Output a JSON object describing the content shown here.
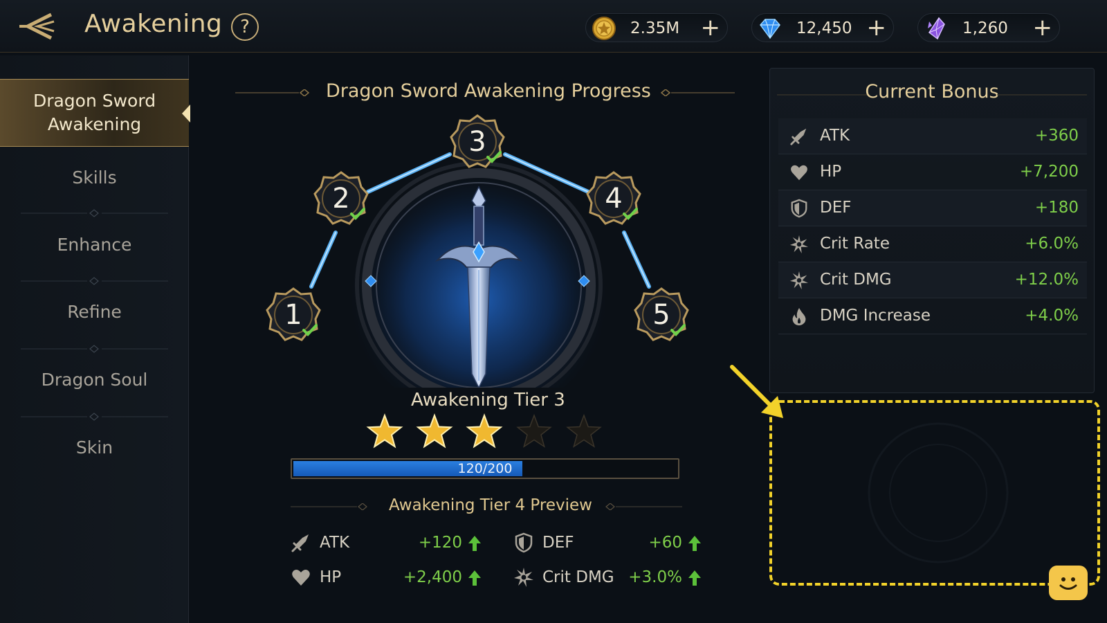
{
  "header": {
    "title": "Awakening",
    "help": "?",
    "currencies": [
      {
        "name": "gold",
        "value": "2.35M",
        "plus": "+"
      },
      {
        "name": "diamond",
        "value": "12,450",
        "plus": "+"
      },
      {
        "name": "crystal",
        "value": "1,260",
        "plus": "+"
      }
    ]
  },
  "sidebar": {
    "items": [
      {
        "label": "Dragon Sword Awakening",
        "active": true
      },
      {
        "label": "Skills"
      },
      {
        "label": "Enhance"
      },
      {
        "label": "Refine"
      },
      {
        "label": "Dragon Soul"
      },
      {
        "label": "Skin"
      }
    ]
  },
  "progress": {
    "title": "Dragon Sword Awakening Progress",
    "nodes": [
      "1",
      "2",
      "3",
      "4",
      "5"
    ],
    "tier_label": "Awakening Tier 3",
    "stars_filled": 3,
    "stars_total": 5,
    "bar_text": "120/200",
    "bar_value": 120,
    "bar_max": 200
  },
  "preview": {
    "title": "Awakening Tier 4 Preview",
    "stats": [
      {
        "label": "ATK",
        "value": "+120"
      },
      {
        "label": "DEF",
        "value": "+60"
      },
      {
        "label": "HP",
        "value": "+2,400"
      },
      {
        "label": "Crit DMG",
        "value": "+3.0%"
      }
    ]
  },
  "bonus": {
    "title": "Current Bonus",
    "rows": [
      {
        "label": "ATK",
        "value": "+360",
        "icon": "sword-icon"
      },
      {
        "label": "HP",
        "value": "+7,200",
        "icon": "heart-icon"
      },
      {
        "label": "DEF",
        "value": "+180",
        "icon": "shield-icon"
      },
      {
        "label": "Crit Rate",
        "value": "+6.0%",
        "icon": "crit-icon"
      },
      {
        "label": "Crit DMG",
        "value": "+12.0%",
        "icon": "crit-icon"
      },
      {
        "label": "DMG Increase",
        "value": "+4.0%",
        "icon": "flame-icon"
      }
    ]
  },
  "colors": {
    "accent_gold": "#e5cf9c",
    "bonus_green": "#7fcf4a",
    "progress_blue": "#2a7fe0",
    "highlight_yellow": "#f2d22a"
  }
}
